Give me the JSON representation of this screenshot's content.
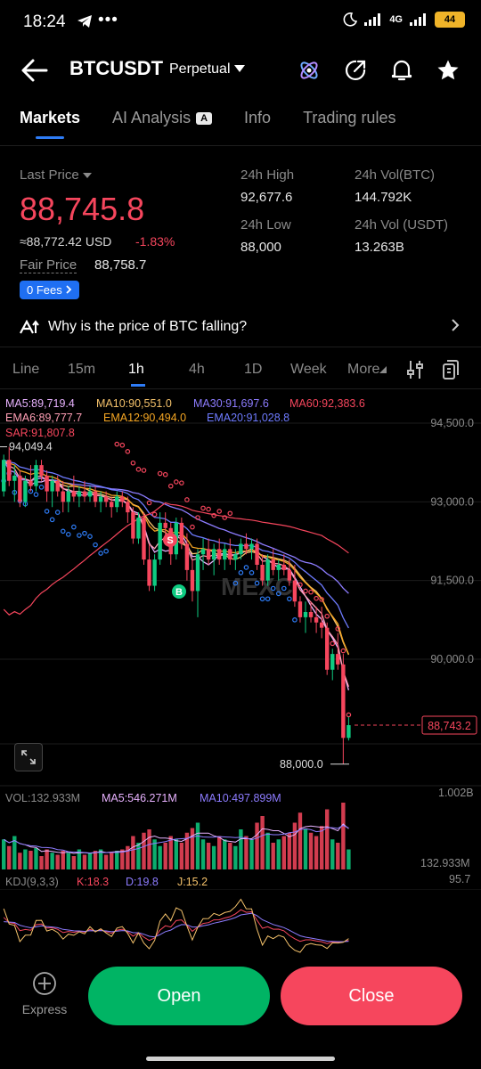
{
  "status_bar": {
    "time": "18:24",
    "network": "4G",
    "battery": "44"
  },
  "header": {
    "symbol": "BTCUSDT",
    "contract": "Perpetual"
  },
  "tabs": [
    {
      "label": "Markets",
      "active": true
    },
    {
      "label": "AI Analysis",
      "badge": "A",
      "active": false
    },
    {
      "label": "Info",
      "active": false
    },
    {
      "label": "Trading rules",
      "active": false
    }
  ],
  "price": {
    "last_label": "Last Price",
    "last_value": "88,745.8",
    "usd_value": "≈88,772.42 USD",
    "change": "-1.83%",
    "fair_label": "Fair Price",
    "fair_value": "88,758.7",
    "fees_label": "0 Fees"
  },
  "stats": {
    "high_label": "24h High",
    "high_value": "92,677.6",
    "low_label": "24h Low",
    "low_value": "88,000",
    "vol_btc_label": "24h Vol(BTC)",
    "vol_btc_value": "144.792K",
    "vol_usdt_label": "24h Vol (USDT)",
    "vol_usdt_value": "13.263B"
  },
  "ai_question": "Why is the price of BTC falling?",
  "timeframes": [
    "Line",
    "15m",
    "1h",
    "4h",
    "1D",
    "Week",
    "More"
  ],
  "active_timeframe": "1h",
  "indicators": {
    "ma5": "MA5:89,719.4",
    "ma10": "MA10:90,551.0",
    "ma30": "MA30:91,697.6",
    "ma60": "MA60:92,383.6",
    "ema6": "EMA6:89,777.7",
    "ema12": "EMA12:90,494.0",
    "ema20": "EMA20:91,028.8",
    "sar": "SAR:91,807.8"
  },
  "chart_data": {
    "type": "candlestick",
    "y_ticks": [
      "94,500.0",
      "93,000.0",
      "91,500.0",
      "90,000.0"
    ],
    "y_tick_values": [
      94500,
      93000,
      91500,
      90000
    ],
    "high_marker": "94,049.4",
    "low_marker": "88,000.0",
    "current_price": "88,743.2",
    "current_price_value": 88743.2,
    "buy_marker": "B",
    "sell_marker": "S",
    "watermark": "MEXC",
    "candles": [
      [
        93200,
        93900,
        93100,
        93800
      ],
      [
        93800,
        94049.4,
        93300,
        93400
      ],
      [
        93400,
        93700,
        93000,
        93500
      ],
      [
        93500,
        93600,
        92900,
        93000
      ],
      [
        93000,
        93500,
        92900,
        93400
      ],
      [
        93400,
        93700,
        93200,
        93300
      ],
      [
        93300,
        93800,
        93200,
        93700
      ],
      [
        93700,
        93800,
        93400,
        93500
      ],
      [
        93500,
        93600,
        93000,
        93200
      ],
      [
        93200,
        93500,
        92900,
        93400
      ],
      [
        93400,
        93500,
        93100,
        93200
      ],
      [
        93200,
        93400,
        92800,
        93000
      ],
      [
        93000,
        93300,
        92800,
        93200
      ],
      [
        93200,
        93500,
        93000,
        93100
      ],
      [
        93100,
        93300,
        92900,
        93200
      ],
      [
        93200,
        93400,
        93000,
        93100
      ],
      [
        93100,
        93300,
        93000,
        93200
      ],
      [
        93200,
        93300,
        92900,
        93000
      ],
      [
        93000,
        93200,
        92800,
        93100
      ],
      [
        93100,
        93200,
        92900,
        93000
      ],
      [
        93000,
        93100,
        92700,
        92900
      ],
      [
        92900,
        93200,
        92800,
        93100
      ],
      [
        93100,
        93200,
        92900,
        93000
      ],
      [
        93000,
        93100,
        92600,
        92800
      ],
      [
        92800,
        92900,
        92200,
        92300
      ],
      [
        92300,
        92800,
        92200,
        92700
      ],
      [
        92700,
        92800,
        91800,
        91900
      ],
      [
        91900,
        92200,
        91300,
        91400
      ],
      [
        91400,
        92000,
        91300,
        91900
      ],
      [
        91900,
        92800,
        91800,
        92600
      ],
      [
        92600,
        92800,
        92300,
        92500
      ],
      [
        92500,
        92600,
        91800,
        92000
      ],
      [
        92000,
        92700,
        91900,
        92600
      ],
      [
        92600,
        92700,
        92100,
        92200
      ],
      [
        92200,
        92400,
        91500,
        91700
      ],
      [
        91700,
        91900,
        91100,
        91300
      ],
      [
        91300,
        92100,
        90800,
        92000
      ],
      [
        92000,
        92300,
        91700,
        92100
      ],
      [
        92100,
        92300,
        91800,
        91900
      ],
      [
        91900,
        92200,
        91600,
        92100
      ],
      [
        92100,
        92300,
        91800,
        91900
      ],
      [
        91900,
        92200,
        91700,
        92100
      ],
      [
        92100,
        92300,
        91800,
        91900
      ],
      [
        91900,
        92100,
        91700,
        92000
      ],
      [
        92000,
        92300,
        91900,
        92200
      ],
      [
        92200,
        92400,
        92000,
        92100
      ],
      [
        92100,
        92300,
        91900,
        92200
      ],
      [
        92200,
        92300,
        91700,
        91800
      ],
      [
        91800,
        92000,
        91400,
        91500
      ],
      [
        91500,
        92000,
        91400,
        91900
      ],
      [
        91900,
        92100,
        91600,
        91700
      ],
      [
        91700,
        91900,
        91500,
        91800
      ],
      [
        91800,
        92000,
        91600,
        91700
      ],
      [
        91700,
        91900,
        91400,
        91500
      ],
      [
        91500,
        91800,
        91000,
        91100
      ],
      [
        91100,
        91200,
        90700,
        90800
      ],
      [
        90800,
        91100,
        90500,
        90900
      ],
      [
        90900,
        91100,
        90700,
        90800
      ],
      [
        90800,
        91000,
        90500,
        90700
      ],
      [
        90700,
        91000,
        90400,
        90600
      ],
      [
        90600,
        90700,
        89700,
        89800
      ],
      [
        89800,
        90200,
        89600,
        90100
      ],
      [
        90100,
        90500,
        89800,
        89900
      ],
      [
        89900,
        90100,
        88000,
        88500
      ],
      [
        88500,
        88900,
        88450,
        88743.2
      ]
    ]
  },
  "volume": {
    "label": "VOL:132.933M",
    "ma5": "MA5:546.271M",
    "ma10": "MA10:497.899M",
    "max_label": "1.002B",
    "min_label": "132.933M",
    "values": [
      0.45,
      0.35,
      0.5,
      0.25,
      0.3,
      0.28,
      0.32,
      0.2,
      0.3,
      0.25,
      0.22,
      0.28,
      0.25,
      0.2,
      0.3,
      0.22,
      0.25,
      0.28,
      0.3,
      0.22,
      0.25,
      0.28,
      0.3,
      0.35,
      0.5,
      0.4,
      0.55,
      0.6,
      0.45,
      0.35,
      0.4,
      0.5,
      0.45,
      0.4,
      0.55,
      0.62,
      0.7,
      0.45,
      0.4,
      0.35,
      0.5,
      0.45,
      0.4,
      0.35,
      0.6,
      0.5,
      0.45,
      0.7,
      0.8,
      0.55,
      0.4,
      0.45,
      0.5,
      0.55,
      0.7,
      0.85,
      0.6,
      0.55,
      0.5,
      0.65,
      0.9,
      0.45,
      0.4,
      1.0,
      0.3
    ]
  },
  "kdj": {
    "label": "KDJ(9,3,3)",
    "k": "K:18.3",
    "d": "D:19.8",
    "j": "J:15.2",
    "max_label": "95.7"
  },
  "bottom": {
    "express_label": "Express",
    "open_label": "Open",
    "close_label": "Close"
  },
  "colors": {
    "up": "#0ecb81",
    "down": "#f6465d",
    "accent": "#2e7cf6",
    "ma5": "#e8b2ff",
    "ma10": "#f5c26b",
    "ma30": "#8d7cff",
    "ma60": "#f6465d",
    "ema6": "#ff9fb5",
    "ema12": "#f5a623",
    "ema20": "#6e7bff",
    "sar": "#f6465d"
  }
}
